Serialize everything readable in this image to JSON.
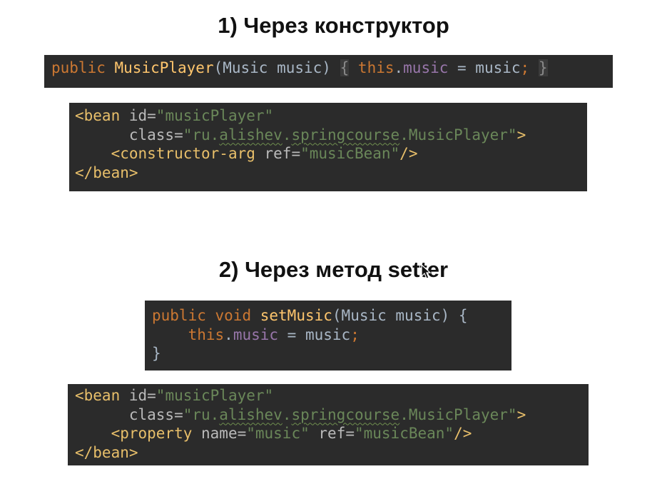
{
  "section1": {
    "heading": "1) Через конструктор",
    "java": {
      "t1": "public",
      "t2": " ",
      "t3": "MusicPlayer",
      "t4": "(Music music) ",
      "t5": "{",
      "t6": " ",
      "t7": "this",
      "t8": ".",
      "t9": "music",
      "t10": " = music",
      "t11": ";",
      "t12": " ",
      "t13": "}"
    },
    "xml": {
      "l1_open": "<bean ",
      "l1_attr": "id=",
      "l1_val": "\"musicPlayer\"",
      "l2_indent": "      ",
      "l2_attr": "class=",
      "l2_q1": "\"ru.",
      "l2_w1": "alishev",
      "l2_dot1": ".",
      "l2_w2": "springcourse",
      "l2_rest": ".MusicPlayer\"",
      "l2_close": ">",
      "l3_indent": "    ",
      "l3_open": "<constructor-arg ",
      "l3_attr": "ref=",
      "l3_val": "\"musicBean\"",
      "l3_close": "/>",
      "l4": "</bean>"
    }
  },
  "section2": {
    "heading": "2) Через метод setter",
    "java": {
      "l1_kw1": "public",
      "l1_sp1": " ",
      "l1_kw2": "void",
      "l1_sp2": " ",
      "l1_fn": "setMusic",
      "l1_rest": "(Music music) {",
      "l2_indent": "    ",
      "l2_kw": "this",
      "l2_dot": ".",
      "l2_field": "music",
      "l2_rest": " = music",
      "l2_semi": ";",
      "l3": "}"
    },
    "xml": {
      "l1_open": "<bean ",
      "l1_attr": "id=",
      "l1_val": "\"musicPlayer\"",
      "l2_indent": "      ",
      "l2_attr": "class=",
      "l2_q1": "\"ru.",
      "l2_w1": "alishev",
      "l2_dot1": ".",
      "l2_w2": "springcourse",
      "l2_rest": ".MusicPlayer\"",
      "l2_close": ">",
      "l3_indent": "    ",
      "l3_open": "<property ",
      "l3_attr1": "name=",
      "l3_val1": "\"music\"",
      "l3_sp": " ",
      "l3_attr2": "ref=",
      "l3_val2": "\"musicBean\"",
      "l3_close": "/>",
      "l4": "</bean>"
    }
  },
  "colors": {
    "code_background": "#2b2b2b",
    "keyword": "#cc7832",
    "function": "#ffc66d",
    "field": "#9876aa",
    "string": "#6a8759",
    "tag": "#e8bf6a",
    "plain": "#a9b7c6"
  }
}
